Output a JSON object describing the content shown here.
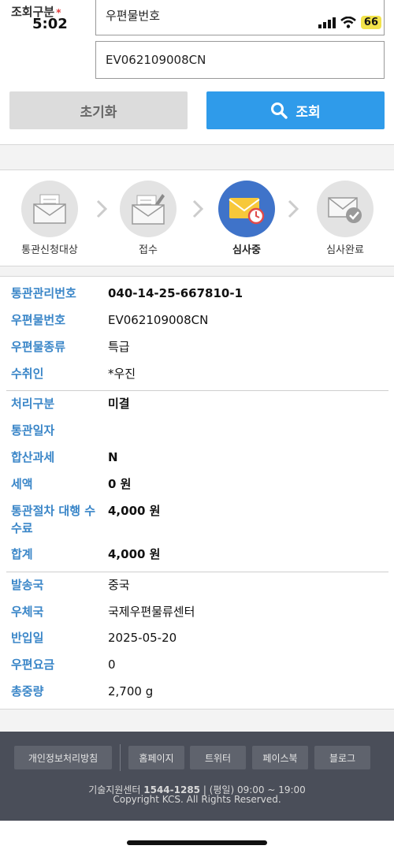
{
  "status_bar": {
    "time": "5:02",
    "battery": "66"
  },
  "search": {
    "label": "조회구분",
    "required_mark": "*",
    "type_value": "우편물번호",
    "number_value": "EV062109008CN",
    "reset_label": "초기화",
    "search_label": "조회"
  },
  "steps": [
    {
      "label": "통관신청대상",
      "icon": "mail-document-icon",
      "active": false
    },
    {
      "label": "접수",
      "icon": "mail-edit-icon",
      "active": false
    },
    {
      "label": "심사중",
      "icon": "mail-clock-icon",
      "active": true
    },
    {
      "label": "심사완료",
      "icon": "mail-check-icon",
      "active": false
    }
  ],
  "info": {
    "group1": [
      {
        "label": "통관관리번호",
        "value": "040-14-25-667810-1",
        "bold": true
      },
      {
        "label": "우편물번호",
        "value": "EV062109008CN",
        "bold": false
      },
      {
        "label": "우편물종류",
        "value": "특급",
        "bold": false
      },
      {
        "label": "수취인",
        "value": "*우진",
        "bold": false
      }
    ],
    "group2": [
      {
        "label": "처리구분",
        "value": "미결",
        "bold": true
      },
      {
        "label": "통관일자",
        "value": "",
        "bold": false
      },
      {
        "label": "합산과세",
        "value": "N",
        "bold": true
      },
      {
        "label": "세액",
        "value": "0 원",
        "bold": true
      },
      {
        "label": "통관절차 대행 수수료",
        "value": "4,000 원",
        "bold": true
      },
      {
        "label": "합계",
        "value": "4,000 원",
        "bold": true
      }
    ],
    "group3": [
      {
        "label": "발송국",
        "value": "중국",
        "bold": false
      },
      {
        "label": "우체국",
        "value": "국제우편물류센터",
        "bold": false
      },
      {
        "label": "반입일",
        "value": "2025-05-20",
        "bold": false
      },
      {
        "label": "우편요금",
        "value": "0",
        "bold": false
      },
      {
        "label": "총중량",
        "value": "2,700 g",
        "bold": false
      }
    ]
  },
  "footer": {
    "links": [
      "개인정보처리방침",
      "홈페이지",
      "트위터",
      "페이스북",
      "블로그"
    ],
    "support_prefix": "기술지원센터 ",
    "support_phone": "1544-1285",
    "support_hours": " | (평일) 09:00 ~ 19:00",
    "copyright": "Copyright KCS. All Rights Reserved."
  },
  "colors": {
    "accent": "#2f9bea",
    "label_blue": "#3a86c8",
    "active_step": "#3f73c9",
    "footer_bg": "#4a4e59"
  }
}
